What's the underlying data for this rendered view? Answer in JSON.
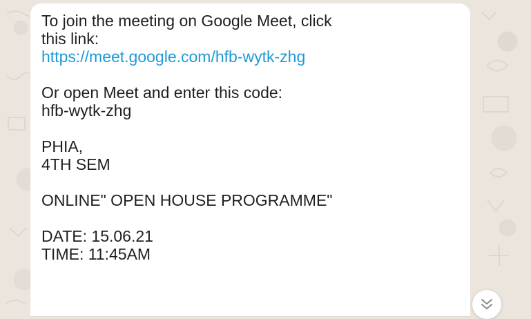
{
  "message": {
    "line1": "To join the meeting on Google Meet, click",
    "line2": "this link:",
    "link": "https://meet.google.com/hfb-wytk-zhg",
    "line4": "Or open Meet and enter this code:",
    "line5": "hfb-wytk-zhg",
    "line6": "PHIA,",
    "line7": "4TH SEM",
    "line8": "ONLINE\" OPEN HOUSE PROGRAMME\"",
    "line9": "DATE: 15.06.21",
    "line10": "TIME: 11:45AM"
  },
  "scroll_down": {
    "icon": "double-chevron-down-icon"
  },
  "colors": {
    "wallpaper": "#ece5dd",
    "bubble": "#ffffff",
    "link": "#1e9ad6",
    "text": "#1f1f1f"
  }
}
